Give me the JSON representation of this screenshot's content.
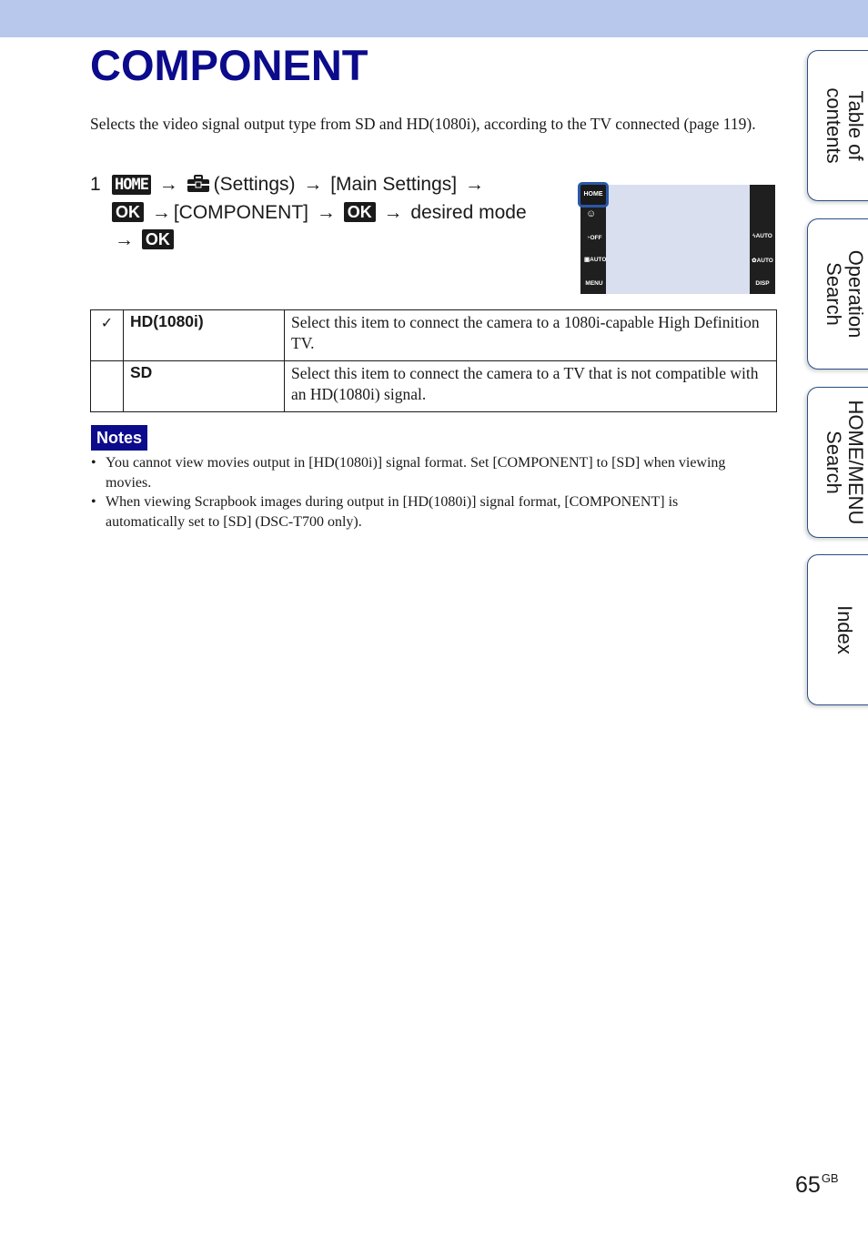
{
  "header": {
    "title": "COMPONENT",
    "band_color": "#b8c8ec",
    "title_color": "#0b0b8c"
  },
  "intro": "Selects the video signal output type from SD and HD(1080i), according to the TV connected (page 119).",
  "step": {
    "number": "1",
    "home_key": "HOME",
    "settings_label": "(Settings)",
    "main_settings": "[Main Settings]",
    "ok_key": "OK",
    "component": "[COMPONENT]",
    "desired_mode": "desired mode",
    "arrow": "→"
  },
  "camera_screen": {
    "home_button": "HOME",
    "left_icons": [
      "smile",
      "self-timer OFF",
      "scene AUTO",
      "MENU"
    ],
    "menu_label": "MENU",
    "self_timer_label": "OFF",
    "scene_label": "AUTO",
    "flash_label": "AUTO",
    "macro_label": "AUTO",
    "disp_label": "DISP"
  },
  "options": [
    {
      "selected": true,
      "check_icon": "✓",
      "name": "HD(1080i)",
      "description": "Select this item to connect the camera to a 1080i-capable High Definition TV."
    },
    {
      "selected": false,
      "check_icon": "",
      "name": "SD",
      "description": "Select this item to connect the camera to a TV that is not compatible with an HD(1080i) signal."
    }
  ],
  "notes": {
    "label": "Notes",
    "items": [
      "You cannot view movies output in [HD(1080i)] signal format. Set [COMPONENT] to [SD] when viewing movies.",
      "When viewing Scrapbook images during output in [HD(1080i)] signal format, [COMPONENT] is automatically set to [SD] (DSC-T700 only)."
    ]
  },
  "side_tabs": [
    {
      "line1": "Table of",
      "line2": "contents"
    },
    {
      "line1": "Operation",
      "line2": "Search"
    },
    {
      "line1": "HOME/MENU",
      "line2": "Search"
    },
    {
      "line1": "Index",
      "line2": ""
    }
  ],
  "footer": {
    "page_number": "65",
    "suffix": "GB"
  }
}
